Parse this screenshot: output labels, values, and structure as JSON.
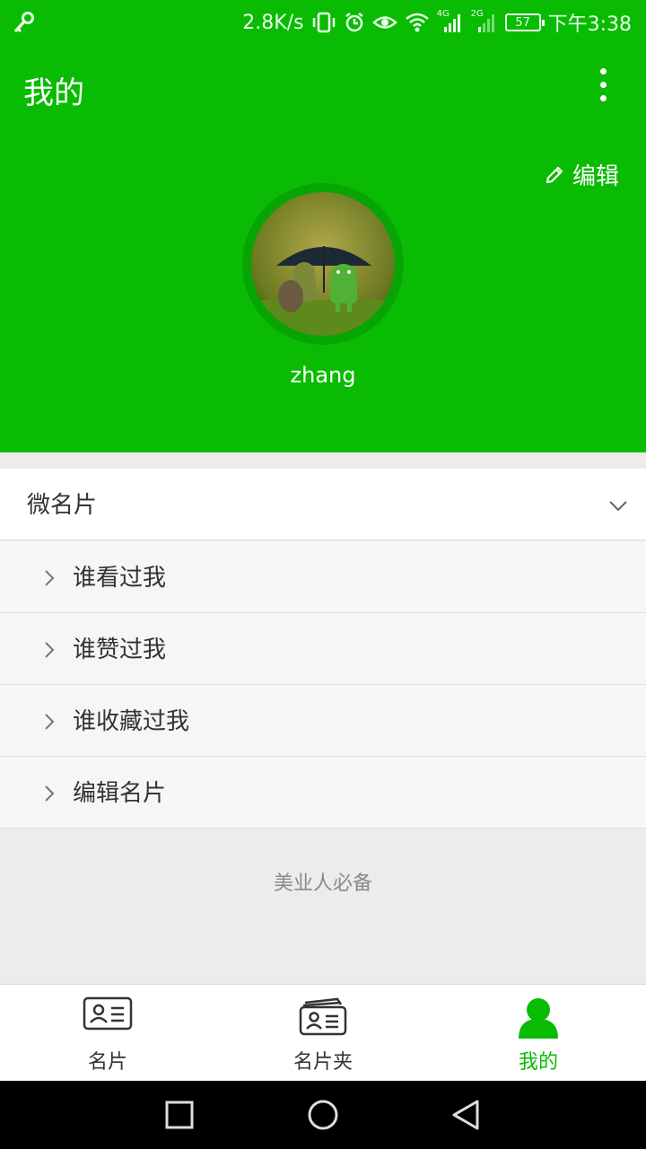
{
  "status_bar": {
    "speed": "2.8K/s",
    "net_4g": "4G",
    "net_2g": "2G",
    "battery": "57",
    "time": "下午3:38"
  },
  "header": {
    "title": "我的",
    "edit_label": "编辑",
    "username": "zhang"
  },
  "section": {
    "title": "微名片",
    "items": [
      {
        "label": "谁看过我"
      },
      {
        "label": "谁赞过我"
      },
      {
        "label": "谁收藏过我"
      },
      {
        "label": "编辑名片"
      }
    ]
  },
  "tagline": "美业人必备",
  "bottom_nav": {
    "items": [
      {
        "label": "名片",
        "icon": "card-icon"
      },
      {
        "label": "名片夹",
        "icon": "card-holder-icon"
      },
      {
        "label": "我的",
        "icon": "person-icon",
        "active": true
      }
    ]
  },
  "colors": {
    "brand_green": "#0abb04",
    "avatar_ring": "#07a404"
  }
}
